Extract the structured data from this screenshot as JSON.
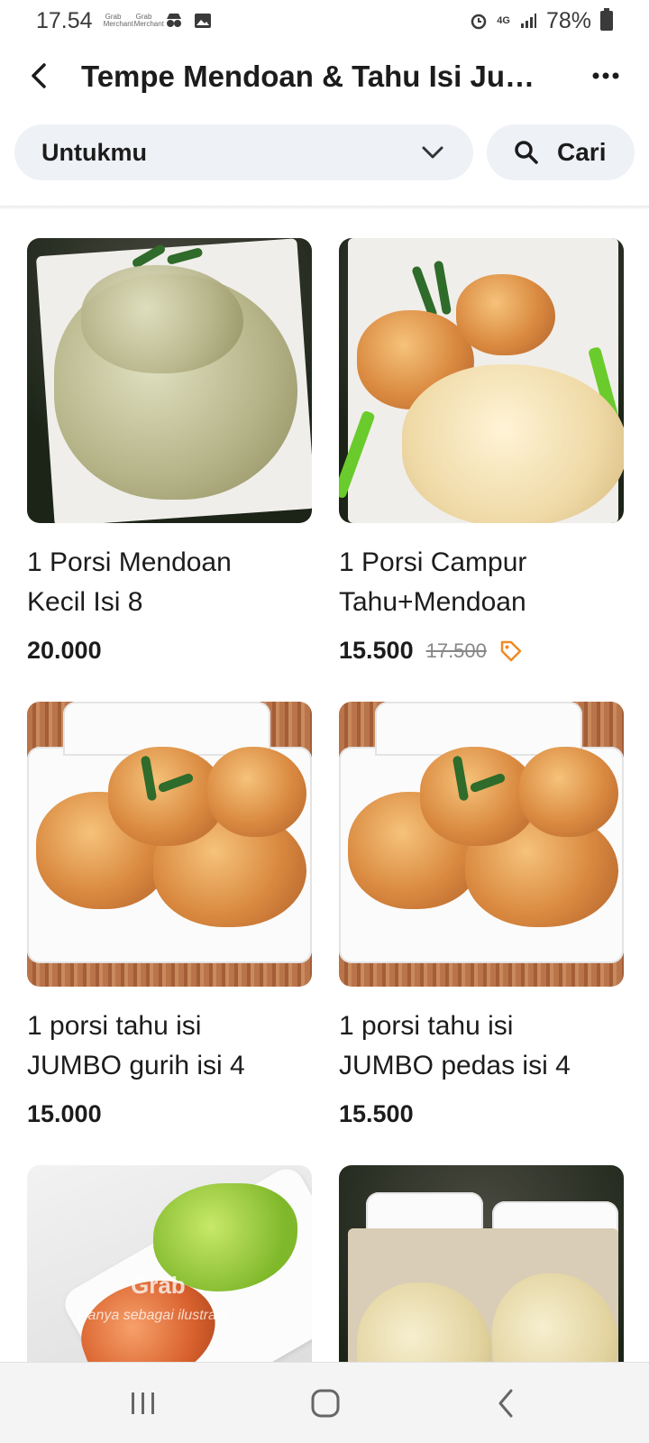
{
  "status_bar": {
    "time": "17.54",
    "mini_labels": [
      "Grab Merchant",
      "Grab Merchant"
    ],
    "network": "4G",
    "battery": "78%"
  },
  "header": {
    "title": "Tempe Mendoan & Tahu Isi Jumbo...",
    "back_icon": "arrow-left-icon",
    "more_icon": "more-dots-icon"
  },
  "filters": {
    "category_value": "Untukmu",
    "search_label": "Cari"
  },
  "menu_items": [
    {
      "name_line1": "1 Porsi Mendoan",
      "name_line2": "Kecil Isi 8",
      "price": "20.000"
    },
    {
      "name_line1": "1 Porsi Campur",
      "name_line2": "Tahu+Mendoan",
      "price": "15.500",
      "old_price": "17.500"
    },
    {
      "name_line1": "1 porsi tahu isi",
      "name_line2": "JUMBO gurih isi 4",
      "price": "15.000"
    },
    {
      "name_line1": "1 porsi tahu isi",
      "name_line2": "JUMBO pedas isi 4",
      "price": "15.500"
    },
    {
      "watermark_brand": "Grab",
      "watermark_text": "Hanya sebagai ilustrasi"
    },
    {}
  ],
  "colors": {
    "promo": "#f08a24",
    "chip_bg": "#eef1f5",
    "text": "#1c1c1c"
  }
}
